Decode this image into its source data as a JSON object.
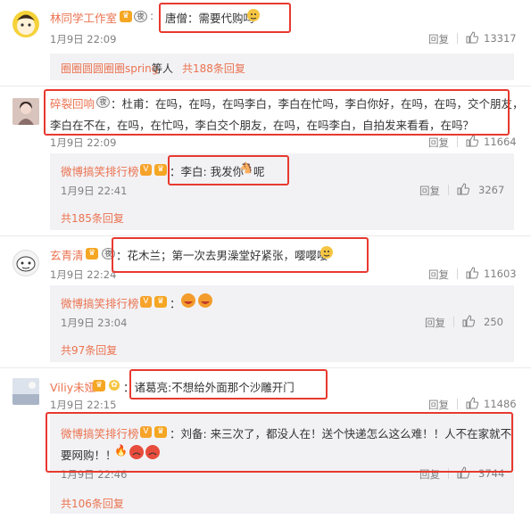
{
  "labels": {
    "reply": "回复"
  },
  "c1": {
    "name": "林同学工作室",
    "text": "唐僧：需要代购吗",
    "time": "1月9日 22:09",
    "likes": "13317",
    "more_user": "圈圈圆圆圈圈spring",
    "more_mid": " 等人 ",
    "more_link": "共188条回复"
  },
  "c2": {
    "name": "碎裂回响",
    "line1": "：杜甫：在吗，在吗，在吗李白，李白在忙吗，李白你好，在吗，在吗，交个朋友，",
    "line2": "李白在不在，在吗，在忙吗，李白交个朋友，在吗，在吗李白，自拍发来看看，在吗？",
    "time": "1月9日 22:09",
    "likes": "11664",
    "sub_name": "微博搞笑排行榜",
    "sub_text": "：李白: 我发你",
    "sub_text2": "呢",
    "sub_time": "1月9日 22:41",
    "sub_likes": "3267",
    "more": "共185条回复"
  },
  "c3": {
    "name": "玄青清",
    "text": "：花木兰；第一次去男澡堂好紧张，嘤嘤嘤",
    "time": "1月9日 22:24",
    "likes": "11603",
    "sub_name": "微博搞笑排行榜",
    "sub_text": "：",
    "sub_time": "1月9日 23:04",
    "sub_likes": "250",
    "more": "共97条回复"
  },
  "c4": {
    "name": "Viliy未娅",
    "text": "：诸葛亮:不想给外面那个沙雕开门",
    "time": "1月9日 22:15",
    "likes": "11486",
    "sub_name": "微博搞笑排行榜",
    "sub_line1": "：刘备: 来三次了，都没人在！送个快递怎么这么难！！人不在家就不",
    "sub_line2": "要网购！！",
    "sub_time": "1月9日 22:46",
    "sub_likes": "3744",
    "more": "共106条回复"
  },
  "icons": [
    "thumb-up-icon",
    "vip-crown-icon",
    "verified-v-icon",
    "night-mode-badge-icon",
    "emoji-icons",
    "fire-icon"
  ],
  "colors": {
    "name": "#eb7350",
    "meta": "#808080",
    "highlight": "#e8392f",
    "subbox": "#f2f2f5"
  }
}
